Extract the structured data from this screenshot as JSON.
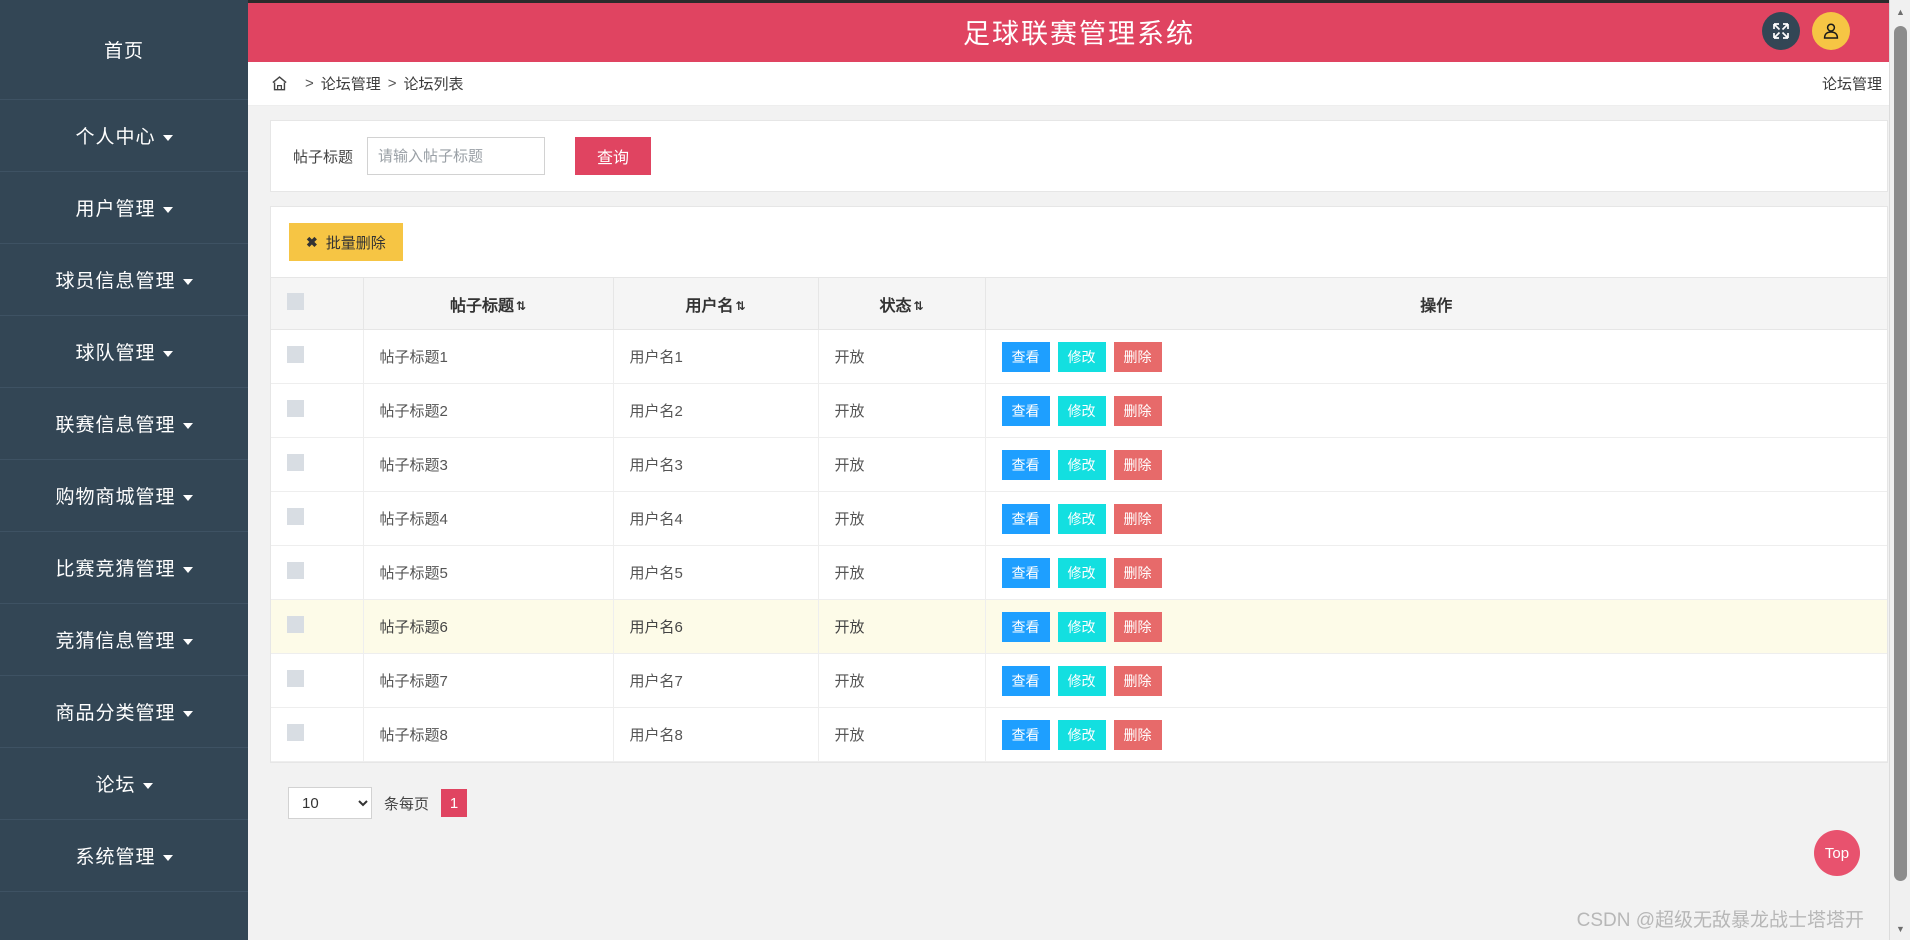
{
  "header": {
    "title": "足球联赛管理系统",
    "fullscreen_icon": "fullscreen-expand-icon",
    "user_icon": "user-avatar-icon"
  },
  "sidebar": {
    "items": [
      {
        "label": "首页",
        "has_caret": false
      },
      {
        "label": "个人中心",
        "has_caret": true
      },
      {
        "label": "用户管理",
        "has_caret": true
      },
      {
        "label": "球员信息管理",
        "has_caret": true
      },
      {
        "label": "球队管理",
        "has_caret": true
      },
      {
        "label": "联赛信息管理",
        "has_caret": true
      },
      {
        "label": "购物商城管理",
        "has_caret": true
      },
      {
        "label": "比赛竞猜管理",
        "has_caret": true
      },
      {
        "label": "竞猜信息管理",
        "has_caret": true
      },
      {
        "label": "商品分类管理",
        "has_caret": true
      },
      {
        "label": "论坛",
        "has_caret": true
      },
      {
        "label": "系统管理",
        "has_caret": true
      }
    ]
  },
  "breadcrumb": {
    "home_icon": "home-icon",
    "separator": ">",
    "items": [
      "论坛管理",
      "论坛列表"
    ],
    "right_label": "论坛管理"
  },
  "search": {
    "label": "帖子标题",
    "placeholder": "请输入帖子标题",
    "value": "",
    "button": "查询"
  },
  "toolbar": {
    "bulk_delete": "批量删除",
    "bulk_delete_icon": "✖"
  },
  "table": {
    "columns": [
      {
        "label": "",
        "sortable": false
      },
      {
        "label": "帖子标题",
        "sortable": true
      },
      {
        "label": "用户名",
        "sortable": true
      },
      {
        "label": "状态",
        "sortable": true
      },
      {
        "label": "操作",
        "sortable": false
      }
    ],
    "sort_glyph": "⇅",
    "actions": {
      "view": "查看",
      "edit": "修改",
      "delete": "删除"
    },
    "rows": [
      {
        "title": "帖子标题1",
        "user": "用户名1",
        "state": "开放",
        "highlight": false
      },
      {
        "title": "帖子标题2",
        "user": "用户名2",
        "state": "开放",
        "highlight": false
      },
      {
        "title": "帖子标题3",
        "user": "用户名3",
        "state": "开放",
        "highlight": false
      },
      {
        "title": "帖子标题4",
        "user": "用户名4",
        "state": "开放",
        "highlight": false
      },
      {
        "title": "帖子标题5",
        "user": "用户名5",
        "state": "开放",
        "highlight": false
      },
      {
        "title": "帖子标题6",
        "user": "用户名6",
        "state": "开放",
        "highlight": true
      },
      {
        "title": "帖子标题7",
        "user": "用户名7",
        "state": "开放",
        "highlight": false
      },
      {
        "title": "帖子标题8",
        "user": "用户名8",
        "state": "开放",
        "highlight": false
      }
    ]
  },
  "pagination": {
    "page_size": "10",
    "page_size_options": [
      "10",
      "20",
      "50",
      "100"
    ],
    "per_page_label": "条每页",
    "current_page": "1"
  },
  "floating": {
    "top_button": "Top",
    "watermark": "CSDN @超级无敌暴龙战士塔塔开"
  },
  "colors": {
    "brand_pink": "#e04461",
    "sidebar_dark": "#334655",
    "accent_yellow": "#f6c544",
    "btn_view_blue": "#1e9fff",
    "btn_edit_cyan": "#13dfe0",
    "btn_delete_red": "#e76a6a",
    "row_highlight": "#fdfbe8"
  }
}
